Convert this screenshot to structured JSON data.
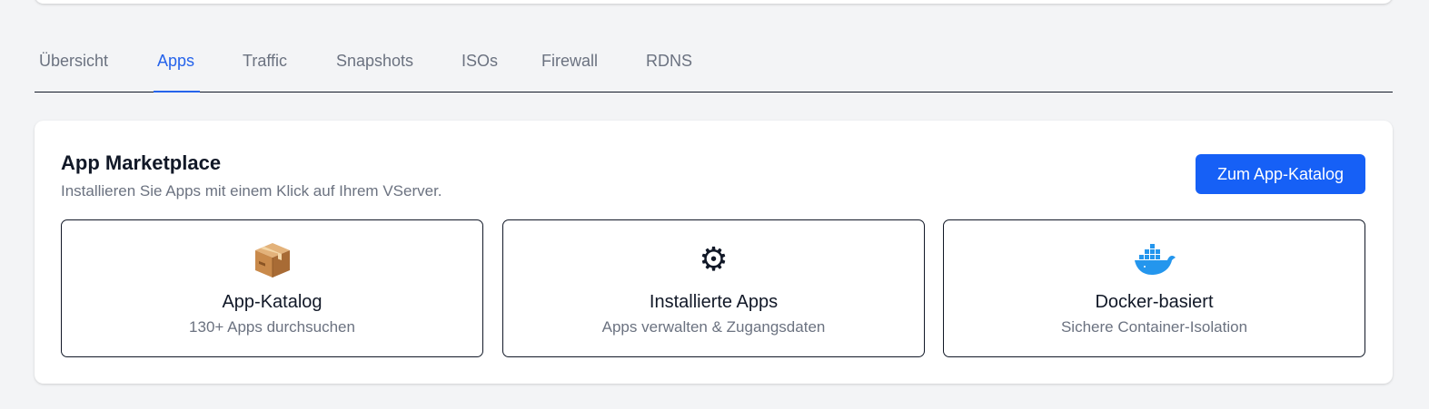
{
  "tabs": [
    {
      "label": "Übersicht",
      "active": false
    },
    {
      "label": "Apps",
      "active": true
    },
    {
      "label": "Traffic",
      "active": false
    },
    {
      "label": "Snapshots",
      "active": false
    },
    {
      "label": "ISOs",
      "active": false
    },
    {
      "label": "Firewall",
      "active": false
    },
    {
      "label": "RDNS",
      "active": false
    }
  ],
  "marketplace": {
    "title": "App Marketplace",
    "subtitle": "Installieren Sie Apps mit einem Klick auf Ihrem VServer.",
    "catalog_button_label": "Zum App-Katalog",
    "features": [
      {
        "icon": "package-icon",
        "title": "App-Katalog",
        "description": "130+ Apps durchsuchen"
      },
      {
        "icon": "gear-icon",
        "title": "Installierte Apps",
        "description": "Apps verwalten & Zugangsdaten"
      },
      {
        "icon": "docker-whale-icon",
        "title": "Docker-basiert",
        "description": "Sichere Container-Isolation"
      }
    ]
  },
  "colors": {
    "accent": "#2563eb",
    "button": "#1660f6",
    "background": "#f3f4f6",
    "text_primary": "#111827",
    "text_muted": "#6b7280"
  }
}
